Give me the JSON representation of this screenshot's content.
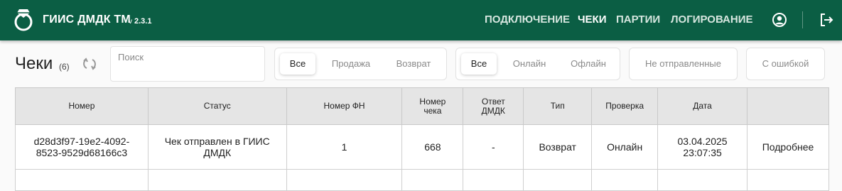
{
  "header": {
    "title": "ГИИС ДМДК ТМ",
    "version_prefix": "v",
    "version": "2.3.1",
    "nav": [
      "ПОДКЛЮЧЕНИЕ",
      "ЧЕКИ",
      "ПАРТИИ",
      "ЛОГИРОВАНИЕ"
    ],
    "active_nav": "ЧЕКИ",
    "icons": [
      "logo-icon",
      "account-icon",
      "logout-icon"
    ]
  },
  "page": {
    "title": "Чеки",
    "count": "(6)"
  },
  "search": {
    "placeholder": "Поиск",
    "value": ""
  },
  "filters": {
    "type_group": [
      "Все",
      "Продажа",
      "Возврат"
    ],
    "type_selected": "Все",
    "mode_group": [
      "Все",
      "Онлайн",
      "Офлайн"
    ],
    "mode_selected": "Все",
    "not_sent": "Не отправленные",
    "with_error": "С ошибкой"
  },
  "table": {
    "columns": [
      "Номер",
      "Статус",
      "Номер ФН",
      "Номер\nчека",
      "Ответ\nДМДК",
      "Тип",
      "Проверка",
      "Дата",
      ""
    ],
    "rows": [
      {
        "number": "d28d3f97-19e2-4092-\n8523-9529d68166c3",
        "status": "Чек отправлен в ГИИС\nДМДК",
        "fn": "1",
        "check_no": "668",
        "response": "-",
        "type": "Возврат",
        "check": "Онлайн",
        "date": "03.04.2025\n23:07:35",
        "action": "Подробнее"
      }
    ]
  },
  "colors": {
    "header_bg": "#0b5e44",
    "link": "#1f5fbf",
    "online": "#2e8a2e"
  }
}
